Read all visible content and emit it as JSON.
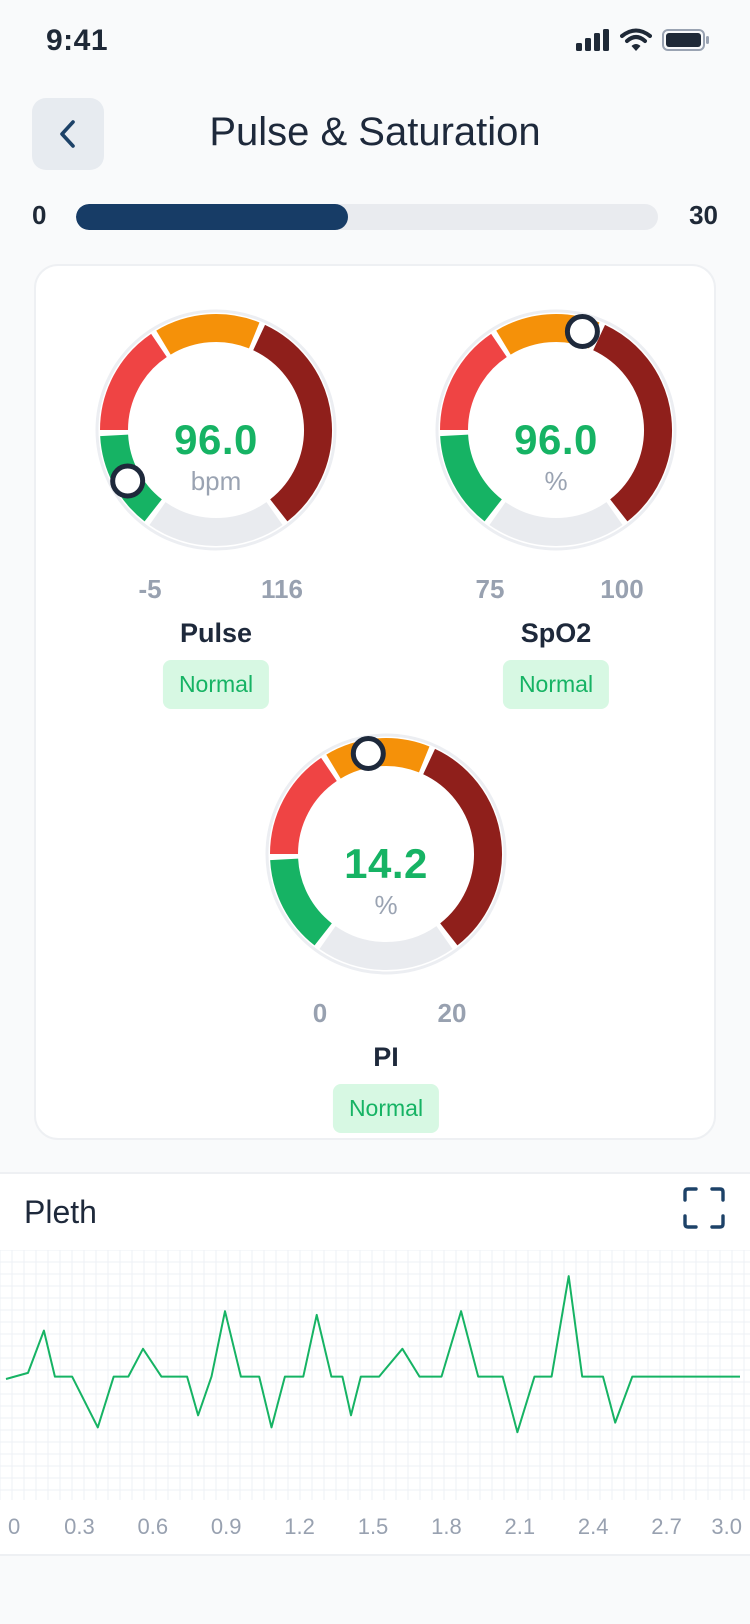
{
  "status_bar": {
    "time": "9:41",
    "icons": [
      "signal-icon",
      "wifi-icon",
      "battery-icon"
    ]
  },
  "header": {
    "title": "Pulse & Saturation",
    "back_icon": "chevron-left-icon"
  },
  "progress": {
    "min_label": "0",
    "max_label": "30",
    "value": 14,
    "max": 30,
    "color": "#173c66"
  },
  "colors": {
    "red": "#ef4444",
    "orange": "#f59109",
    "dark_red": "#8f1f1b",
    "green": "#16b364",
    "track": "#e9ebef",
    "badge_bg": "#d7f8e3"
  },
  "gauges": [
    {
      "label": "Pulse",
      "value": "96.0",
      "unit": "bpm",
      "min": "-5",
      "max": "116",
      "status": "Normal",
      "indicator_deg": 240
    },
    {
      "label": "SpO2",
      "value": "96.0",
      "unit": "%",
      "min": "75",
      "max": "100",
      "status": "Normal",
      "indicator_deg": 15
    },
    {
      "label": "PI",
      "value": "14.2",
      "unit": "%",
      "min": "0",
      "max": "20",
      "status": "Normal",
      "indicator_deg": 350
    }
  ],
  "pleth": {
    "title": "Pleth",
    "fullscreen_icon": "fullscreen-icon"
  },
  "chart_data": {
    "type": "line",
    "title": "Pleth",
    "x_ticks": [
      "0",
      "0.3",
      "0.6",
      "0.9",
      "1.2",
      "1.5",
      "1.8",
      "2.1",
      "2.4",
      "2.7",
      "3.0"
    ],
    "xlim": [
      0,
      3.0
    ],
    "ylim": [
      -1,
      1
    ],
    "grid": true,
    "series": [
      {
        "color": "#16b364",
        "x": [
          0,
          0.09,
          0.155,
          0.2,
          0.27,
          0.375,
          0.44,
          0.5,
          0.56,
          0.635,
          0.74,
          0.785,
          0.84,
          0.895,
          0.96,
          1.035,
          1.085,
          1.14,
          1.215,
          1.27,
          1.33,
          1.375,
          1.41,
          1.45,
          1.525,
          1.62,
          1.69,
          1.78,
          1.86,
          1.93,
          2.03,
          2.09,
          2.16,
          2.23,
          2.3,
          2.355,
          2.44,
          2.49,
          2.56,
          2.63,
          2.71,
          2.79,
          2.86,
          2.96,
          3.0
        ],
        "y": [
          0,
          0.05,
          0.4,
          0.02,
          0.02,
          -0.4,
          0.02,
          0.02,
          0.25,
          0.02,
          0.02,
          -0.3,
          0.02,
          0.56,
          0.02,
          0.02,
          -0.4,
          0.02,
          0.02,
          0.53,
          0.02,
          0.02,
          -0.3,
          0.02,
          0.02,
          0.25,
          0.02,
          0.02,
          0.56,
          0.02,
          0.02,
          -0.44,
          0.02,
          0.02,
          0.85,
          0.02,
          0.02,
          -0.36,
          0.02,
          0.02,
          0.02,
          0.02,
          0.02,
          0.02,
          0.02
        ]
      }
    ]
  }
}
